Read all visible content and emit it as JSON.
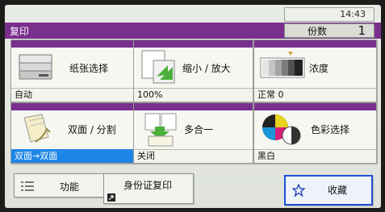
{
  "clock": {
    "time": "14:43"
  },
  "header": {
    "title": "复印",
    "copies_label": "份数",
    "copies_value": "1"
  },
  "tiles": [
    {
      "label": "纸张选择",
      "status": "自动"
    },
    {
      "label": "缩小 / 放大",
      "status": "100%"
    },
    {
      "label": "浓度",
      "status": "正常 0"
    },
    {
      "label": "双面 / 分割",
      "status": "双面→双面"
    },
    {
      "label": "多合一",
      "status": "关闭"
    },
    {
      "label": "色彩选择",
      "status": "黑白"
    }
  ],
  "bottom": {
    "functions": "功能",
    "id_copy": "身份证复印",
    "favorites": "收藏"
  },
  "colors": {
    "accent": "#7a2f8e",
    "selected": "#1e86e6"
  }
}
